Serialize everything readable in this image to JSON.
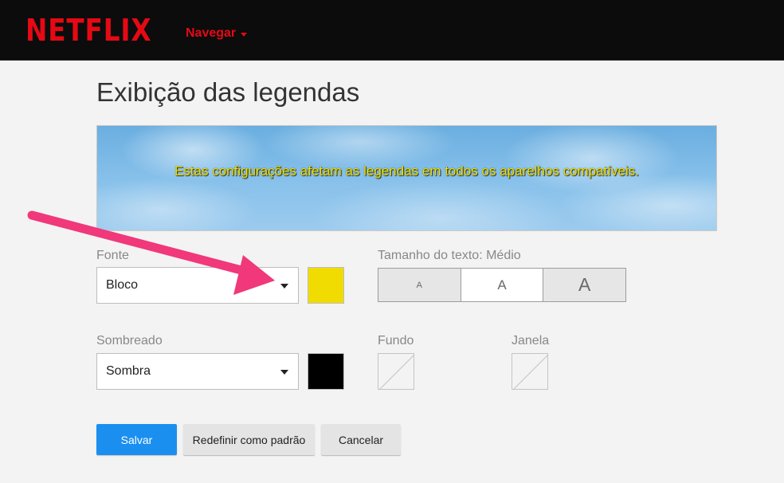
{
  "header": {
    "logo": "NETFLIX",
    "nav_label": "Navegar"
  },
  "page": {
    "title": "Exibição das legendas",
    "preview_text": "Estas configurações afetam as legendas em todos os aparelhos compatíveis."
  },
  "font": {
    "label": "Fonte",
    "value": "Bloco",
    "color": "#f0dc00"
  },
  "text_size": {
    "label": "Tamanho do texto: Médio",
    "options": [
      "A",
      "A",
      "A"
    ],
    "selected_index": 1
  },
  "shadow": {
    "label": "Sombreado",
    "value": "Sombra",
    "color": "#000000"
  },
  "background": {
    "label": "Fundo"
  },
  "window": {
    "label": "Janela"
  },
  "buttons": {
    "save": "Salvar",
    "reset": "Redefinir como padrão",
    "cancel": "Cancelar"
  },
  "colors": {
    "brand": "#e50914",
    "primary_button": "#1b8ff0",
    "annotation_arrow": "#f0387a"
  }
}
